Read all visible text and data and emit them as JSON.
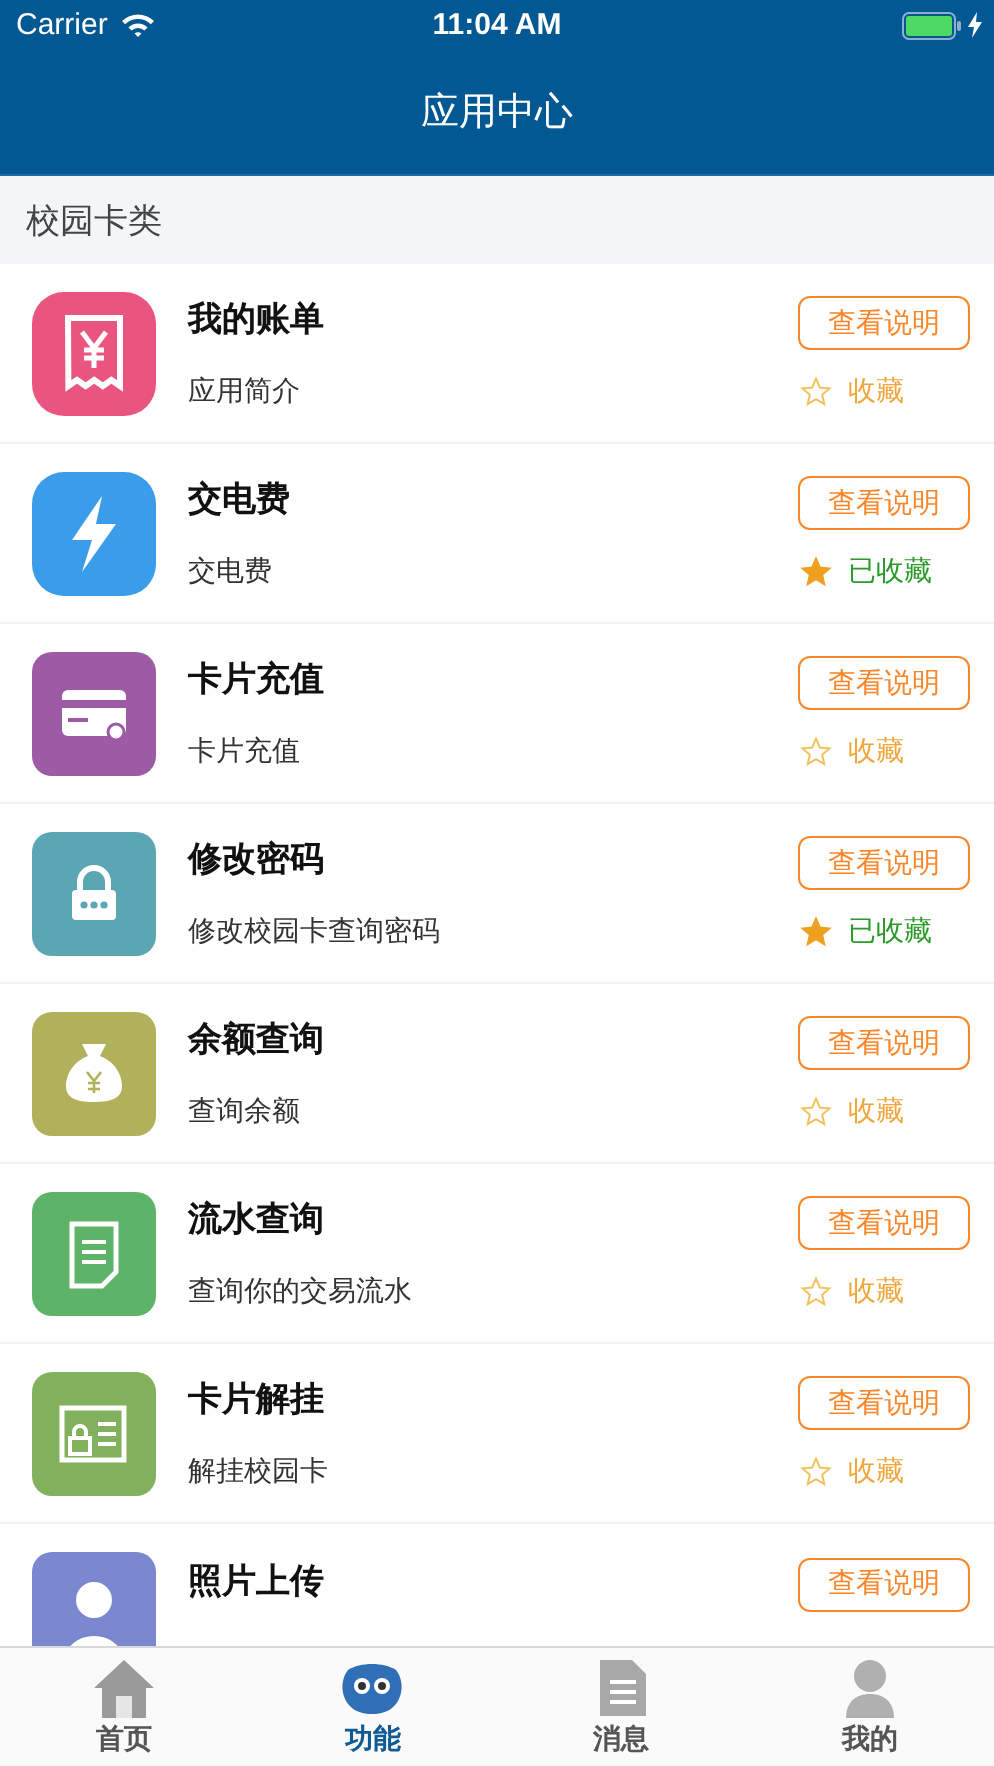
{
  "status_bar": {
    "carrier": "Carrier",
    "time": "11:04 AM"
  },
  "nav_bar": {
    "title": "应用中心"
  },
  "section": {
    "title": "校园卡类"
  },
  "apps": [
    {
      "title": "我的账单",
      "subtitle": "应用简介",
      "button": "查看说明",
      "favorite_label": "收藏",
      "favorited": false
    },
    {
      "title": "交电费",
      "subtitle": "交电费",
      "button": "查看说明",
      "favorite_label": "已收藏",
      "favorited": true
    },
    {
      "title": "卡片充值",
      "subtitle": "卡片充值",
      "button": "查看说明",
      "favorite_label": "收藏",
      "favorited": false
    },
    {
      "title": "修改密码",
      "subtitle": "修改校园卡查询密码",
      "button": "查看说明",
      "favorite_label": "已收藏",
      "favorited": true
    },
    {
      "title": "余额查询",
      "subtitle": "查询余额",
      "button": "查看说明",
      "favorite_label": "收藏",
      "favorited": false
    },
    {
      "title": "流水查询",
      "subtitle": "查询你的交易流水",
      "button": "查看说明",
      "favorite_label": "收藏",
      "favorited": false
    },
    {
      "title": "卡片解挂",
      "subtitle": "解挂校园卡",
      "button": "查看说明",
      "favorite_label": "收藏",
      "favorited": false
    },
    {
      "title": "照片上传",
      "button": "查看说明"
    }
  ],
  "tabs": [
    {
      "label": "首页",
      "selected": false
    },
    {
      "label": "功能",
      "selected": true
    },
    {
      "label": "消息",
      "selected": false
    },
    {
      "label": "我的",
      "selected": false
    }
  ]
}
